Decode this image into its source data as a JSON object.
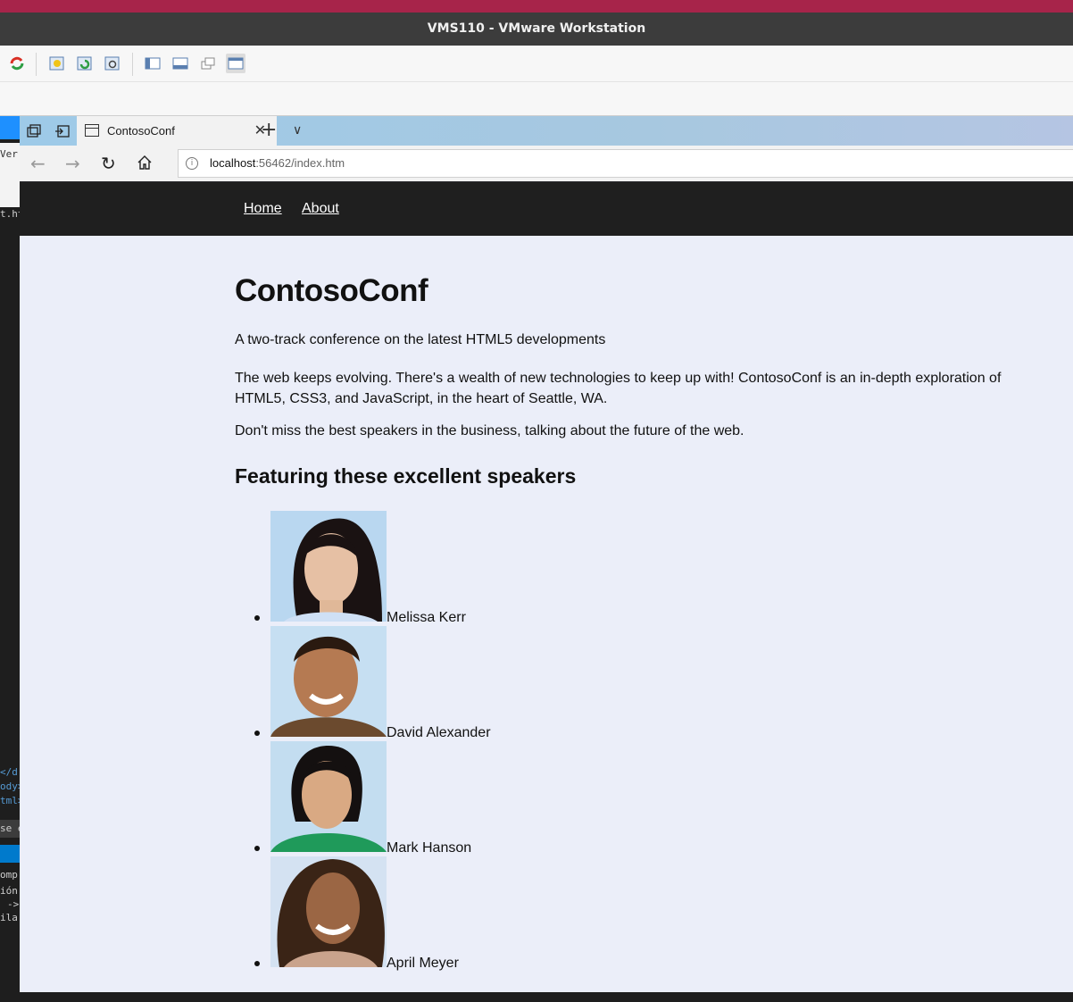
{
  "vm_window": {
    "title": "VMS110 - VMware Workstation"
  },
  "host_sidebar": {
    "snippets": [
      "Ver",
      "t.ht",
      "</d",
      "ody>",
      "tml>",
      "se e",
      "omp",
      "ión",
      "->",
      "ila"
    ]
  },
  "browser": {
    "tab": {
      "title": "ContosoConf"
    },
    "address": {
      "host": "localhost",
      "path": ":56462/index.htm"
    }
  },
  "site": {
    "nav": {
      "home": "Home",
      "about": "About"
    },
    "title": "ContosoConf",
    "tagline": "A two-track conference on the latest HTML5 developments",
    "intro": "The web keeps evolving. There's a wealth of new technologies to keep up with! ContosoConf is an in-depth exploration of HTML5, CSS3, and JavaScript, in the heart of Seattle, WA.",
    "cta": "Don't miss the best speakers in the business, talking about the future of the web.",
    "speakers_heading": "Featuring these excellent speakers",
    "speakers": [
      {
        "name": "Melissa Kerr"
      },
      {
        "name": "David Alexander"
      },
      {
        "name": "Mark Hanson"
      },
      {
        "name": "April Meyer"
      }
    ]
  },
  "colors": {
    "vm_title_bg": "#3c3c3c",
    "system_accent": "#a7244a",
    "site_nav_bg": "#1f1f1f",
    "page_bg": "#ebeef9"
  }
}
